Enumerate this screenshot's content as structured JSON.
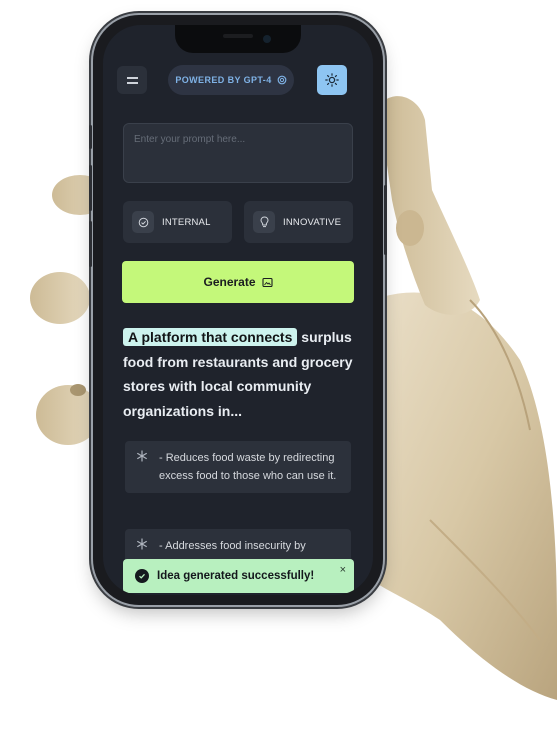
{
  "header": {
    "powered_by": "POWERED BY GPT-4"
  },
  "prompt": {
    "placeholder": "Enter your prompt here..."
  },
  "chips": [
    {
      "label": "INTERNAL",
      "icon": "check-circle-icon"
    },
    {
      "label": "INNOVATIVE",
      "icon": "lightbulb-icon"
    }
  ],
  "generate": {
    "label": "Generate"
  },
  "idea": {
    "highlight": "A platform that connects",
    "rest": "surplus food from restaurants and grocery stores with local community organizations in..."
  },
  "bullets": [
    "- Reduces food waste by redirecting excess food to those who can use it.",
    "- Addresses food insecurity by"
  ],
  "toast": {
    "message": "Idea generated successfully!",
    "close": "×"
  },
  "colors": {
    "accent_green": "#c4f87a",
    "highlight": "#cdf3ee",
    "toast_bg": "#b8f0bf",
    "powered_text": "#7fb2e6",
    "theme_button": "#8ec5f2",
    "screen_bg": "#1f232c"
  }
}
